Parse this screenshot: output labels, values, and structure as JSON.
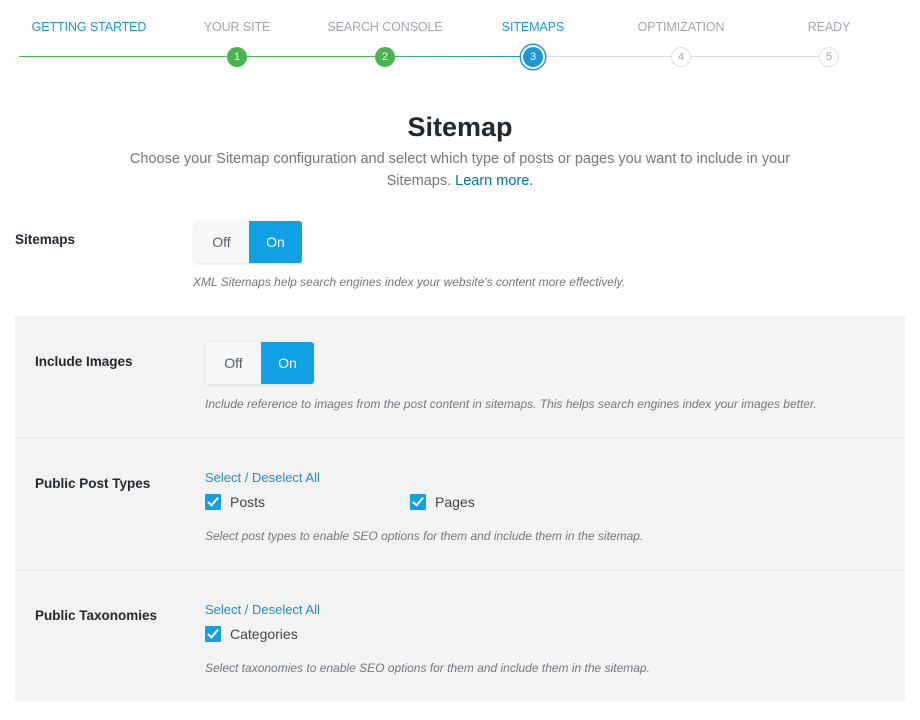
{
  "steps": [
    {
      "label": "Getting Started",
      "number": "",
      "state": "active-label"
    },
    {
      "label": "Your Site",
      "number": "1",
      "state": "done"
    },
    {
      "label": "Search Console",
      "number": "2",
      "state": "done"
    },
    {
      "label": "Sitemaps",
      "number": "3",
      "state": "current"
    },
    {
      "label": "Optimization",
      "number": "4",
      "state": "todo"
    },
    {
      "label": "Ready",
      "number": "5",
      "state": "todo"
    }
  ],
  "header": {
    "title": "Sitemap",
    "intro": "Choose your Sitemap configuration and select which type of posts or pages you want to include in your Sitemaps.",
    "learn_more": "Learn more."
  },
  "colors": {
    "accent": "#10a0e3",
    "done_green": "#4bb34e",
    "link": "#1e8cbe",
    "panel_bg": "#f3f3f3"
  },
  "settings": {
    "sitemaps": {
      "label": "Sitemaps",
      "off": "Off",
      "on": "On",
      "value": "On",
      "description": "XML Sitemaps help search engines index your website's content more effectively."
    },
    "include_images": {
      "label": "Include Images",
      "off": "Off",
      "on": "On",
      "value": "On",
      "description": "Include reference to images from the post content in sitemaps. This helps search engines index your images better."
    },
    "post_types": {
      "label": "Public Post Types",
      "select_all": "Select / Deselect All",
      "options": [
        {
          "label": "Posts",
          "checked": true
        },
        {
          "label": "Pages",
          "checked": true
        }
      ],
      "description": "Select post types to enable SEO options for them and include them in the sitemap."
    },
    "taxonomies": {
      "label": "Public Taxonomies",
      "select_all": "Select / Deselect All",
      "options": [
        {
          "label": "Categories",
          "checked": true
        }
      ],
      "description": "Select taxonomies to enable SEO options for them and include them in the sitemap."
    }
  }
}
